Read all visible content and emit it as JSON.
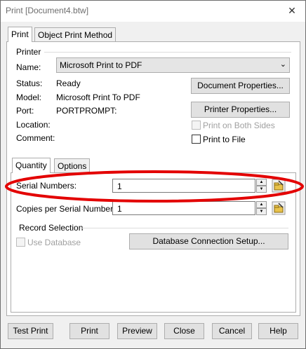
{
  "window": {
    "title": "Print [Document4.btw]",
    "close_glyph": "✕"
  },
  "tabs": {
    "print": "Print",
    "object_print_method": "Object Print Method"
  },
  "printer": {
    "group_label": "Printer",
    "name_label": "Name:",
    "name_value": "Microsoft Print to PDF",
    "status_label": "Status:",
    "status_value": "Ready",
    "model_label": "Model:",
    "model_value": "Microsoft Print To PDF",
    "port_label": "Port:",
    "port_value": "PORTPROMPT:",
    "location_label": "Location:",
    "comment_label": "Comment:",
    "doc_props_button": "Document Properties...",
    "printer_props_button": "Printer Properties...",
    "both_sides_label": "Print on Both Sides",
    "print_to_file_label": "Print to File"
  },
  "subtabs": {
    "quantity": "Quantity",
    "options": "Options"
  },
  "quantity": {
    "serial_numbers_label": "Serial Numbers:",
    "serial_numbers_value": "1",
    "copies_label": "Copies per Serial Number:",
    "copies_value": "1",
    "record_selection_label": "Record Selection",
    "use_database_label": "Use Database",
    "db_setup_button": "Database Connection Setup..."
  },
  "footer": {
    "test_print": "Test Print",
    "print": "Print",
    "preview": "Preview",
    "close": "Close",
    "cancel": "Cancel",
    "help": "Help"
  },
  "colors": {
    "highlight_ellipse": "#e30000"
  }
}
